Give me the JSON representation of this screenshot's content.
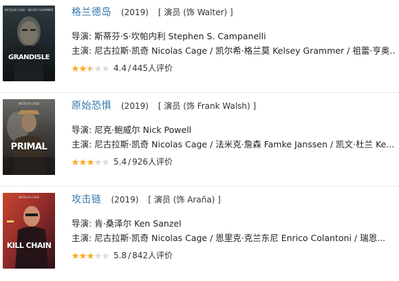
{
  "colors": {
    "link": "#3377aa",
    "star_on": "#ffac2d",
    "star_off": "#dddddd"
  },
  "films": [
    {
      "title": "格兰德岛",
      "year": "(2019)",
      "role": "[ 演员 (饰 Walter) ]",
      "director_label": "导演:",
      "director": "斯蒂芬·S·坎帕内利 Stephen S. Campanelli",
      "cast_label": "主演:",
      "cast": "尼古拉斯·凯奇 Nicolas Cage / 凯尔希·格兰莫 Kelsey Grammer / 祖蕾·亨奥...",
      "stars": 2.5,
      "score": "4.4",
      "votes": "445人评价",
      "poster_title": "GRANDISLE",
      "poster_names": "NICOLAS CAGE · KELSEY GRAMMER"
    },
    {
      "title": "原始恐惧",
      "year": "(2019)",
      "role": "[ 演员 (饰 Frank Walsh) ]",
      "director_label": "导演:",
      "director": "尼克·鲍威尔 Nick Powell",
      "cast_label": "主演:",
      "cast": "尼古拉斯·凯奇 Nicolas Cage / 法米克·詹森 Famke Janssen / 凯文·杜兰 Ke...",
      "stars": 3,
      "score": "5.4",
      "votes": "926人评价",
      "poster_title": "PRIMAL",
      "poster_names": "NICOLAS CAGE"
    },
    {
      "title": "攻击链",
      "year": "(2019)",
      "role": "[ 演员 (饰 Araña) ]",
      "director_label": "导演:",
      "director": "肯·桑泽尔 Ken Sanzel",
      "cast_label": "主演:",
      "cast": "尼古拉斯·凯奇 Nicolas Cage / 恩里克·克兰东尼 Enrico Colantoni / 瑞恩...",
      "stars": 3,
      "score": "5.8",
      "votes": "842人评价",
      "poster_title": "KILL CHAIN",
      "poster_names": "NICOLAS CAGE"
    }
  ]
}
